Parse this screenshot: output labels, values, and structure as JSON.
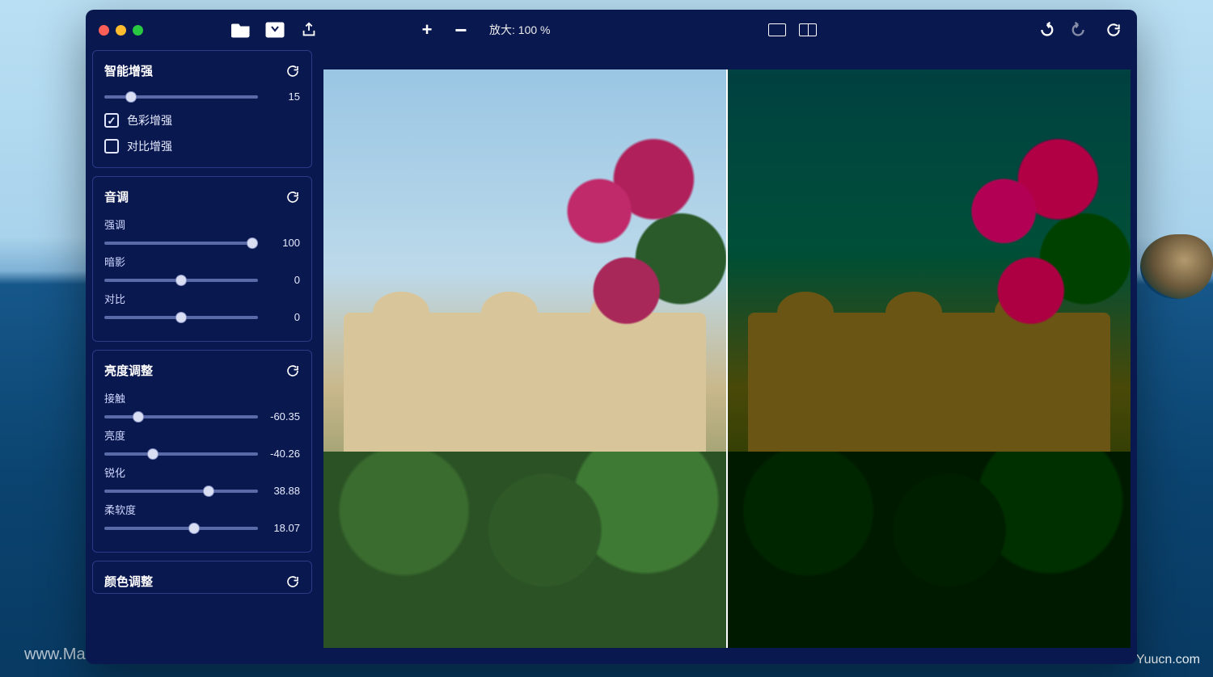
{
  "watermarks": {
    "left": "www.MacW.com",
    "right": "Yuucn.com"
  },
  "toolbar": {
    "zoom_prefix": "放大: ",
    "zoom_value": "100 %",
    "icons": {
      "open": "open-folder-icon",
      "save": "save-icon",
      "share": "share-icon",
      "zoom_in": "plus-icon",
      "zoom_out": "minus-icon",
      "view_single": "single-view-icon",
      "view_split": "split-view-icon",
      "undo": "undo-icon",
      "redo": "redo-icon",
      "revert": "revert-icon"
    }
  },
  "panels": {
    "smart": {
      "title": "智能增强",
      "slider_value": 15,
      "checks": [
        {
          "label": "色彩增强",
          "checked": true
        },
        {
          "label": "对比增强",
          "checked": false
        }
      ]
    },
    "tone": {
      "title": "音调",
      "sliders": [
        {
          "label": "强调",
          "value": 100,
          "display": "100"
        },
        {
          "label": "暗影",
          "value": 0,
          "display": "0"
        },
        {
          "label": "对比",
          "value": 0,
          "display": "0"
        }
      ]
    },
    "brightness": {
      "title": "亮度调整",
      "sliders": [
        {
          "label": "接触",
          "value": -60.35,
          "display": "-60.35"
        },
        {
          "label": "亮度",
          "value": -40.26,
          "display": "-40.26"
        },
        {
          "label": "锐化",
          "value": 38.88,
          "display": "38.88"
        },
        {
          "label": "柔软度",
          "value": 18.07,
          "display": "18.07"
        }
      ]
    },
    "color": {
      "title": "颜色调整"
    }
  }
}
